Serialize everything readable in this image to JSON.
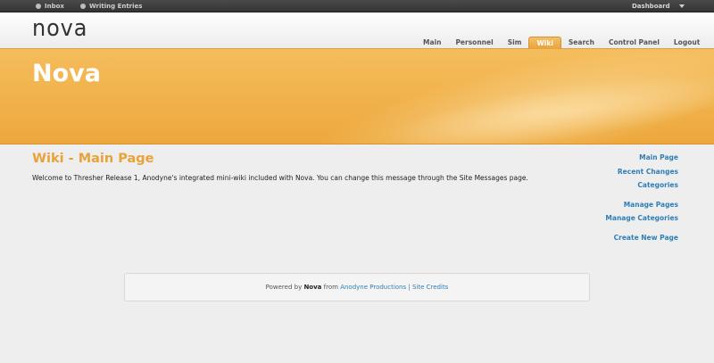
{
  "topbar": {
    "inbox_label": "Inbox",
    "writing_label": "Writing Entries",
    "dashboard_label": "Dashboard"
  },
  "header": {
    "logo_text": "nova",
    "nav": [
      "Main",
      "Personnel",
      "Sim",
      "Wiki",
      "Search",
      "Control Panel",
      "Logout"
    ],
    "active_tab": "Wiki"
  },
  "banner": {
    "title": "Nova"
  },
  "content": {
    "title": "Wiki - Main Page",
    "message": "Welcome to Thresher Release 1, Anodyne's integrated mini-wiki included with Nova. You can change this message through the Site Messages page."
  },
  "sidebar": {
    "group1": [
      "Main Page",
      "Recent Changes",
      "Categories"
    ],
    "group2": [
      "Manage Pages",
      "Manage Categories"
    ],
    "group3": [
      "Create New Page"
    ]
  },
  "footer": {
    "powered_by": "Powered by",
    "product": "Nova",
    "from": "from",
    "company": "Anodyne Productions",
    "separator": "|",
    "credits": "Site Credits"
  },
  "colors": {
    "accent_orange": "#e9a23a",
    "link_blue": "#2f7fb6",
    "topbar_dark": "#3d3d3d"
  }
}
